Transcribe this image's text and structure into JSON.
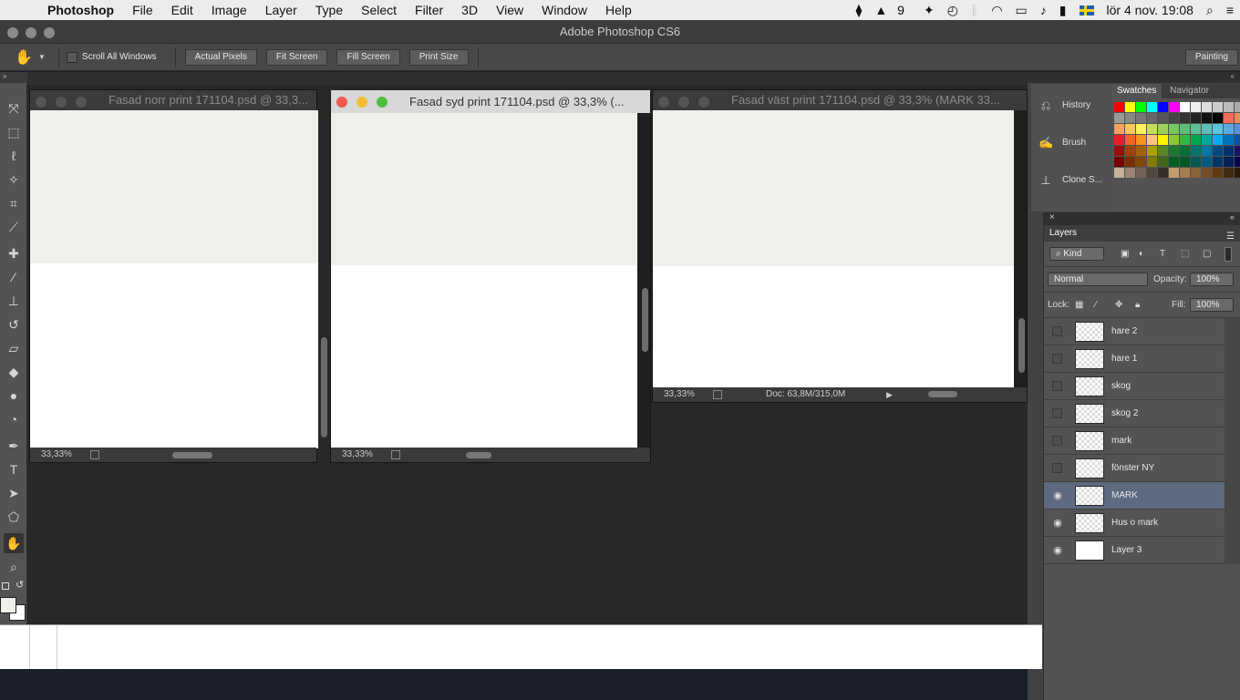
{
  "menubar": {
    "app": "Photoshop",
    "items": [
      "File",
      "Edit",
      "Image",
      "Layer",
      "Type",
      "Select",
      "Filter",
      "3D",
      "View",
      "Window",
      "Help"
    ],
    "status_battery_count": "9",
    "datetime": "lör 4 nov. 19:08"
  },
  "window_title": "Adobe Photoshop CS6",
  "options": {
    "scroll_all": "Scroll All Windows",
    "actual_pixels": "Actual Pixels",
    "fit_screen": "Fit Screen",
    "fill_screen": "Fill Screen",
    "print_size": "Print Size",
    "workspace": "Painting"
  },
  "docs": [
    {
      "title": "Fasad norr print 171104.psd @ 33,3...",
      "zoom": "33,33%"
    },
    {
      "title": "Fasad syd print 171104.psd @ 33,3% (...",
      "zoom": "33,33%"
    },
    {
      "title": "Fasad väst print 171104.psd @ 33,3% (MARK 33...",
      "zoom": "33,33%",
      "doc_info": "Doc: 63,8M/315,0M"
    }
  ],
  "history_dock": {
    "items": [
      "History",
      "Brush",
      "Clone S..."
    ]
  },
  "swatches_panel": {
    "tabs": [
      "Swatches",
      "Navigator"
    ]
  },
  "layers_panel": {
    "title": "Layers",
    "filter": "Kind",
    "blend_mode": "Normal",
    "opacity_label": "Opacity:",
    "opacity": "100%",
    "lock_label": "Lock:",
    "fill_label": "Fill:",
    "fill": "100%",
    "layers": [
      {
        "name": "hare 2",
        "visible": false,
        "selected": false
      },
      {
        "name": "hare 1",
        "visible": false,
        "selected": false
      },
      {
        "name": "skog",
        "visible": false,
        "selected": false
      },
      {
        "name": "skog 2",
        "visible": false,
        "selected": false
      },
      {
        "name": "mark",
        "visible": false,
        "selected": false
      },
      {
        "name": "fönster NY",
        "visible": false,
        "selected": false
      },
      {
        "name": "MARK",
        "visible": true,
        "selected": true
      },
      {
        "name": "Hus o mark",
        "visible": true,
        "selected": false
      },
      {
        "name": "Layer 3",
        "visible": true,
        "selected": false
      }
    ]
  }
}
